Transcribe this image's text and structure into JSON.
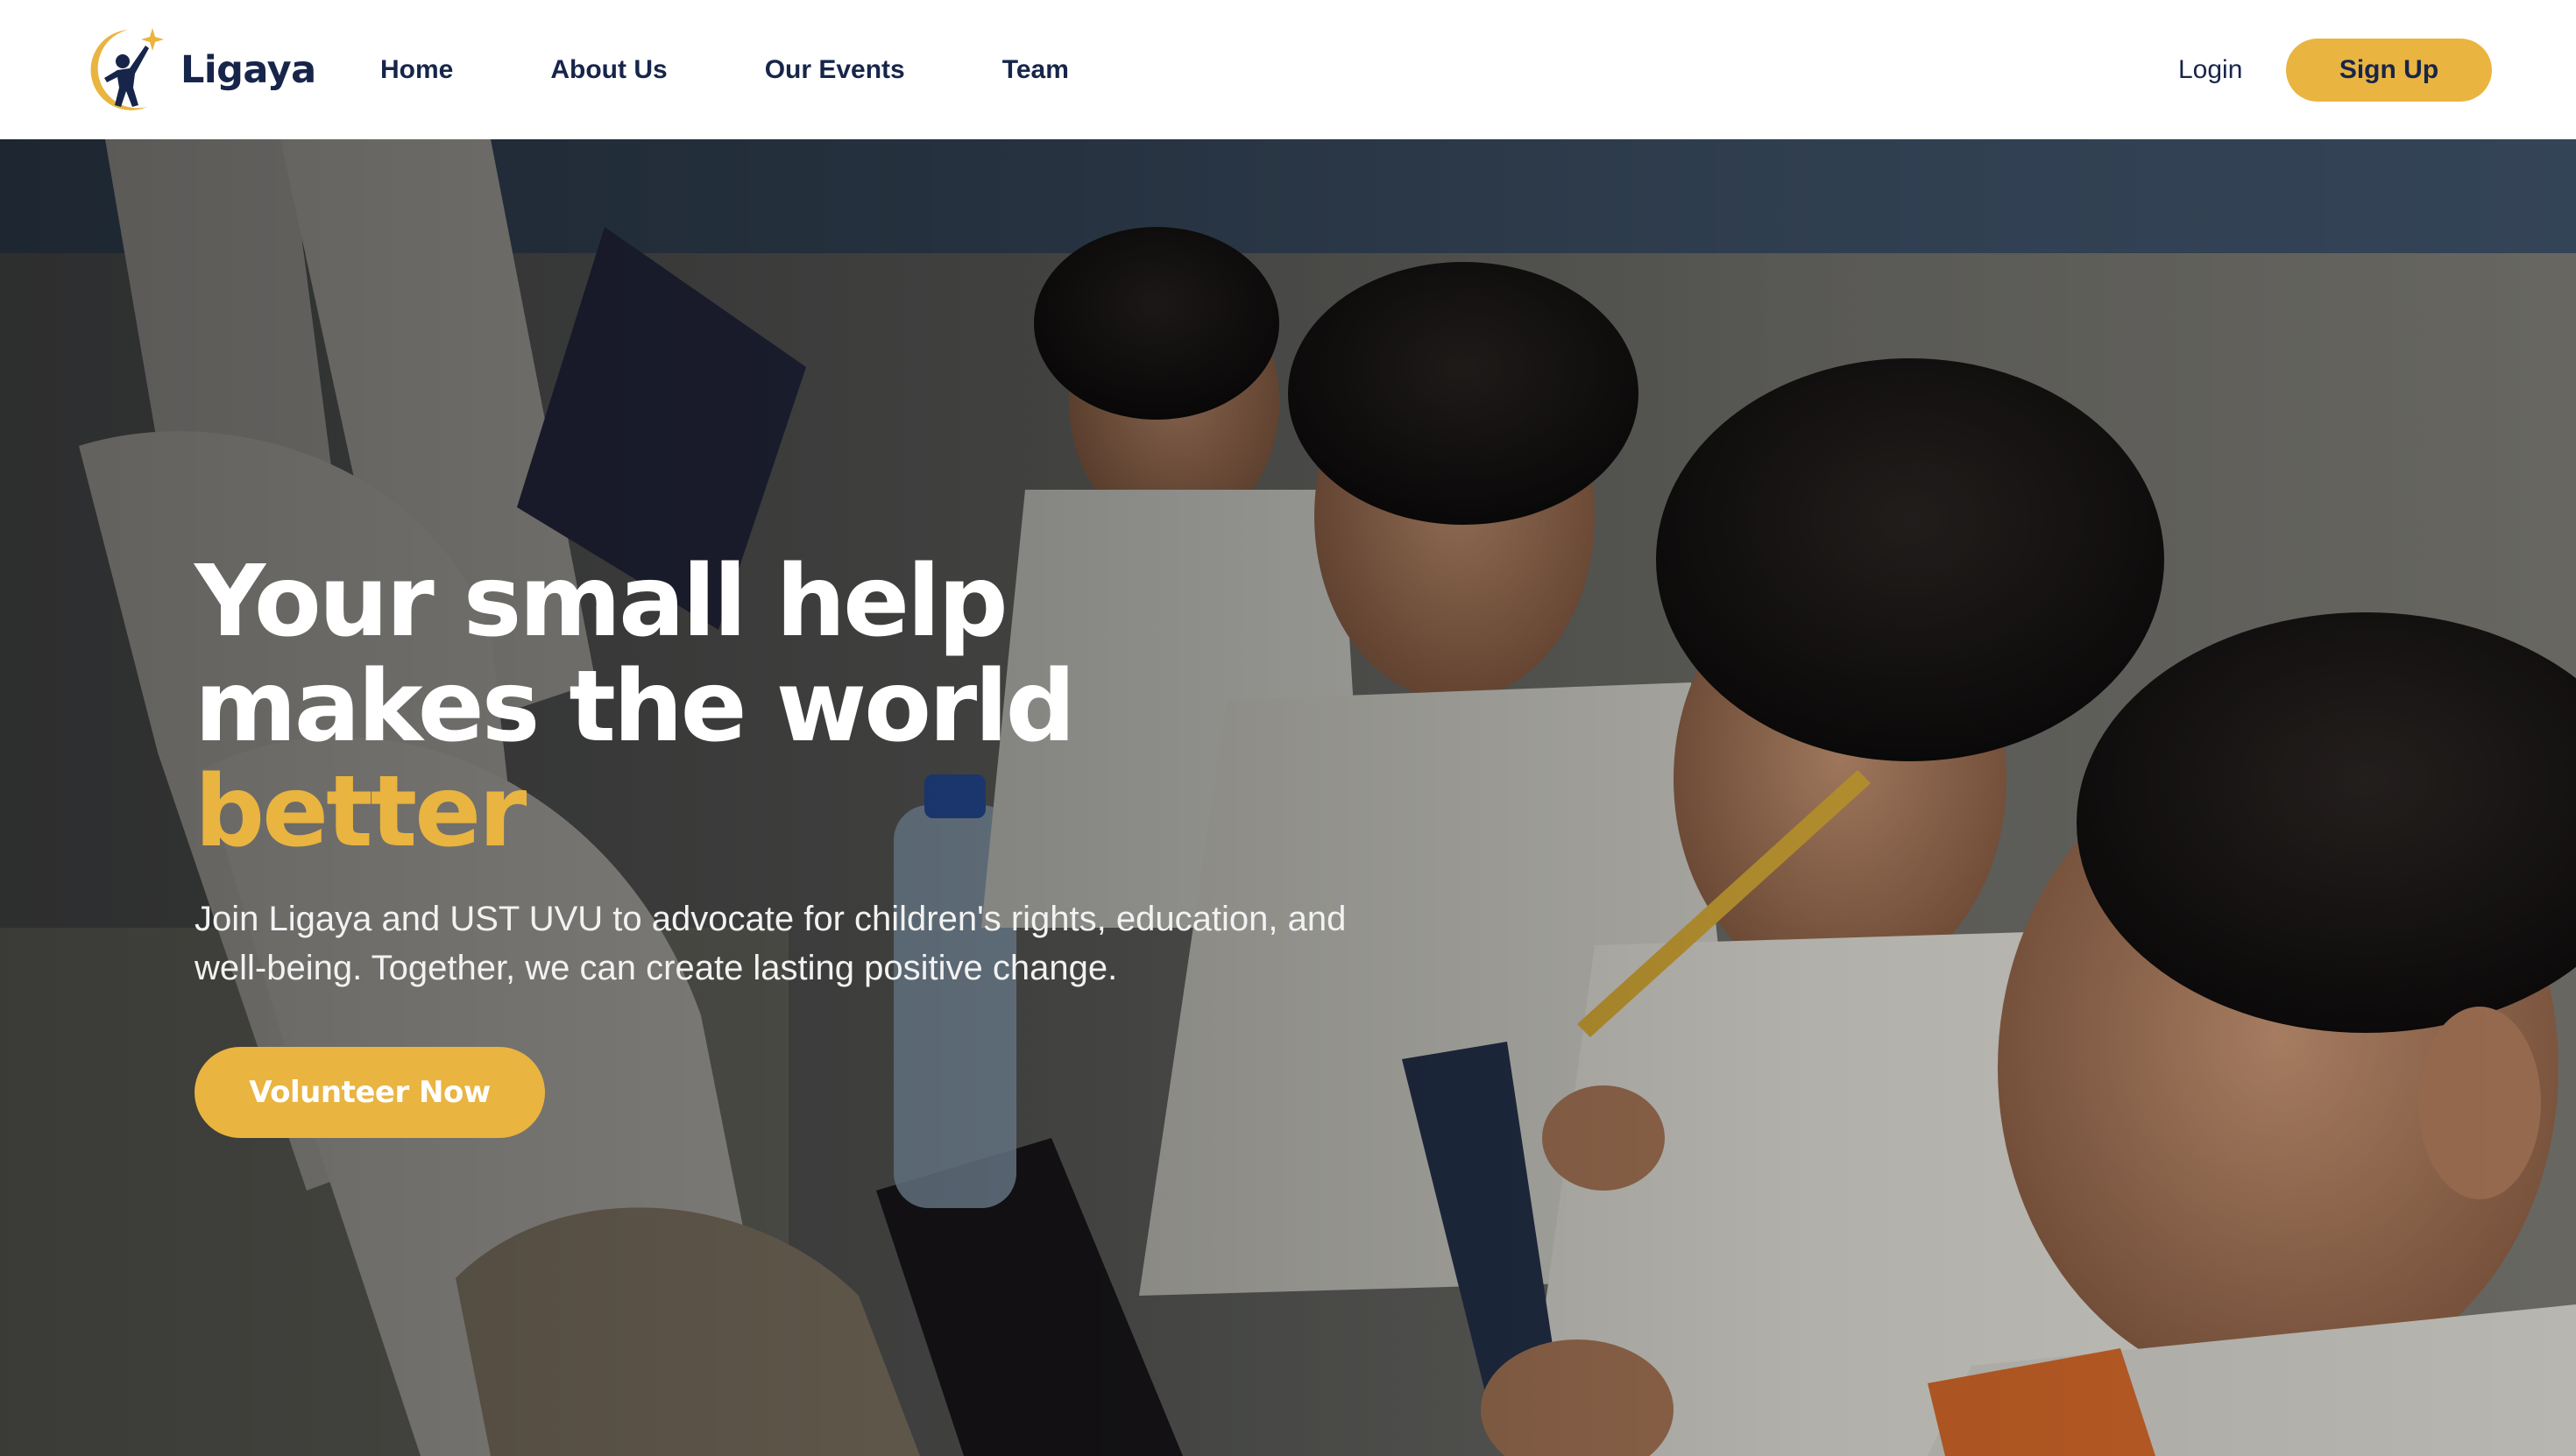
{
  "brand": {
    "name": "Ligaya",
    "logo_icon": "child-reaching-for-star-logo"
  },
  "nav": {
    "links": [
      {
        "label": "Home"
      },
      {
        "label": "About Us"
      },
      {
        "label": "Our Events"
      },
      {
        "label": "Team"
      }
    ],
    "login_label": "Login",
    "signup_label": "Sign Up"
  },
  "hero": {
    "title_line1": "Your small help",
    "title_line2": "makes the world",
    "title_accent": "better",
    "subtitle": "Join Ligaya and UST UVU to advocate for children's rights, education, and well-being. Together, we can create lasting positive change.",
    "cta_label": "Volunteer Now",
    "background_description_icon": "children-reading-photo"
  },
  "colors": {
    "accent": "#e9b440",
    "navy": "#17254a",
    "white": "#ffffff"
  }
}
